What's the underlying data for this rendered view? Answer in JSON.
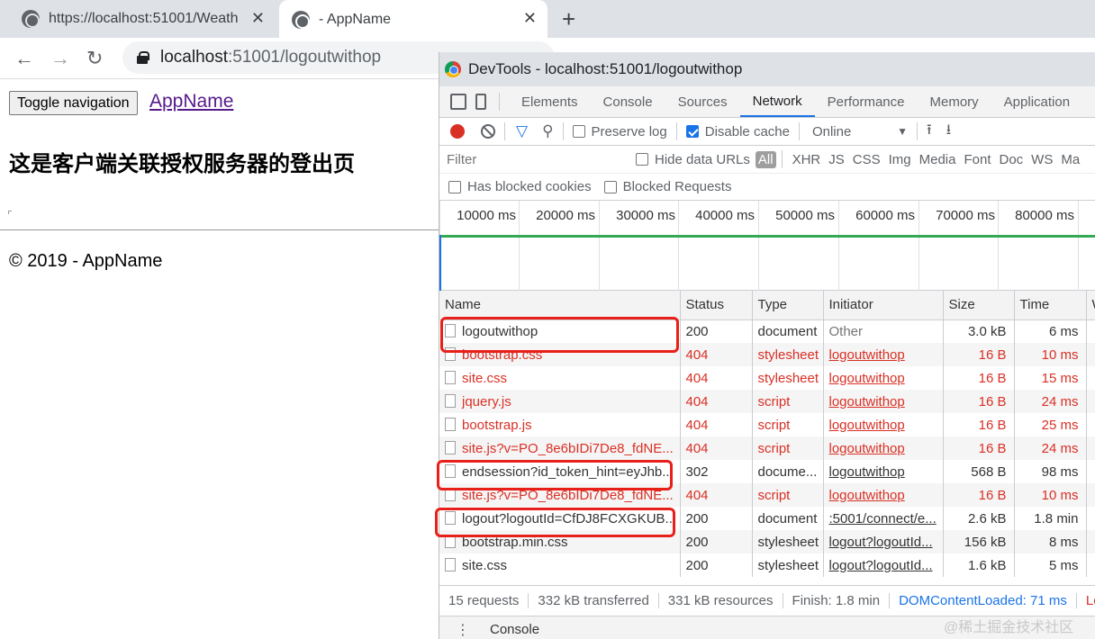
{
  "browser": {
    "tabs": [
      {
        "title": "https://localhost:51001/Weath"
      },
      {
        "title": "- AppName"
      }
    ],
    "url_host": "localhost",
    "url_path": ":51001/logoutwithop"
  },
  "page": {
    "toggle_label": "Toggle navigation",
    "brand": "AppName",
    "heading": "这是客户端关联授权服务器的登出页",
    "footer": "© 2019 - AppName"
  },
  "devtools": {
    "title": "DevTools - localhost:51001/logoutwithop",
    "tabs": [
      "Elements",
      "Console",
      "Sources",
      "Network",
      "Performance",
      "Memory",
      "Application"
    ],
    "active_tab": "Network",
    "preserve_log": "Preserve log",
    "disable_cache": "Disable cache",
    "throttle": "Online",
    "filter_placeholder": "Filter",
    "hide_data_urls": "Hide data URLs",
    "types": [
      "All",
      "XHR",
      "JS",
      "CSS",
      "Img",
      "Media",
      "Font",
      "Doc",
      "WS",
      "Ma"
    ],
    "has_blocked_cookies": "Has blocked cookies",
    "blocked_requests": "Blocked Requests",
    "ticks": [
      "10000 ms",
      "20000 ms",
      "30000 ms",
      "40000 ms",
      "50000 ms",
      "60000 ms",
      "70000 ms",
      "80000 ms"
    ],
    "columns": [
      "Name",
      "Status",
      "Type",
      "Initiator",
      "Size",
      "Time"
    ],
    "rows": [
      {
        "name": "logoutwithop",
        "status": "200",
        "type": "document",
        "initiator": "Other",
        "size": "3.0 kB",
        "time": "6 ms"
      },
      {
        "name": "bootstrap.css",
        "status": "404",
        "type": "stylesheet",
        "initiator": "logoutwithop",
        "size": "16 B",
        "time": "10 ms"
      },
      {
        "name": "site.css",
        "status": "404",
        "type": "stylesheet",
        "initiator": "logoutwithop",
        "size": "16 B",
        "time": "15 ms"
      },
      {
        "name": "jquery.js",
        "status": "404",
        "type": "script",
        "initiator": "logoutwithop",
        "size": "16 B",
        "time": "24 ms"
      },
      {
        "name": "bootstrap.js",
        "status": "404",
        "type": "script",
        "initiator": "logoutwithop",
        "size": "16 B",
        "time": "25 ms"
      },
      {
        "name": "site.js?v=PO_8e6bIDi7De8_fdNE...",
        "status": "404",
        "type": "script",
        "initiator": "logoutwithop",
        "size": "16 B",
        "time": "24 ms"
      },
      {
        "name": "endsession?id_token_hint=eyJhb...",
        "status": "302",
        "type": "docume...",
        "initiator": "logoutwithop",
        "size": "568 B",
        "time": "98 ms"
      },
      {
        "name": "site.js?v=PO_8e6bIDi7De8_fdNE...",
        "status": "404",
        "type": "script",
        "initiator": "logoutwithop",
        "size": "16 B",
        "time": "10 ms"
      },
      {
        "name": "logout?logoutId=CfDJ8FCXGKUB...",
        "status": "200",
        "type": "document",
        "initiator": ":5001/connect/e...",
        "size": "2.6 kB",
        "time": "1.8 min"
      },
      {
        "name": "bootstrap.min.css",
        "status": "200",
        "type": "stylesheet",
        "initiator": "logout?logoutId...",
        "size": "156 kB",
        "time": "8 ms"
      },
      {
        "name": "site.css",
        "status": "200",
        "type": "stylesheet",
        "initiator": "logout?logoutId...",
        "size": "1.6 kB",
        "time": "5 ms"
      }
    ],
    "summary": {
      "requests": "15 requests",
      "transferred": "332 kB transferred",
      "resources": "331 kB resources",
      "finish": "Finish: 1.8 min",
      "dcl": "DOMContentLoaded: 71 ms",
      "load": "Lo"
    },
    "drawer_tab": "Console"
  },
  "colors": {
    "error": "#d93025",
    "accent": "#1a73e8",
    "highlight_box": "#e8201a"
  },
  "watermark": "@稀土掘金技术社区"
}
